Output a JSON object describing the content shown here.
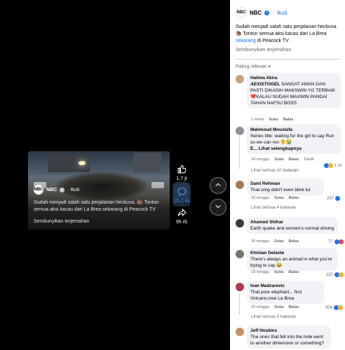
{
  "post": {
    "page_name": "NBC",
    "follow_label": "Ikuti",
    "follow_separator": "·",
    "caption": "Sudah menjadi salah satu perjalanan heckuva. 🦣 Tonton semua aksi kacau dari La Brea",
    "caption_link": "sekarang",
    "caption_tail": "di Peacock TV",
    "hide_translation": "Sembunyikan terjemahan",
    "sort_label": "Paling relevan ▾",
    "logo_text": "NBC"
  },
  "video": {
    "page_name": "NBC",
    "follow_label": "· Ikuti",
    "caption": "Sudah menjadi salah satu perjalanan heckuva. 🦣 Tonton semua aksi kacau dari La Brea sekarang di Peacock TV",
    "hide_translation": "Sembunyikan terjemahan"
  },
  "rail": {
    "likes_count": "1,7 jt",
    "comments_count": "20,2 rb",
    "shares_count": "95 rb"
  },
  "comments": [
    {
      "author": "Halima Akira",
      "text_bold": "AEXISTOGEL",
      "text": " SANGAT AMAN DAN PASTI DIKASIH MAKSWIN YG TERBAIK❤️KALAU SUDAH MAXWIN PANDAI TAHAN NAFSU BOSS",
      "time": "1 menit",
      "like": "Suka",
      "reply": "Balas"
    },
    {
      "author": "Mahmoud Moustafa",
      "text": "Series title: waiting for the girl to say Run so we can run 🫠😭",
      "see_more": "E... Lihat selengkapnya",
      "time": "34 minggu",
      "like": "Suka",
      "reply": "Balas",
      "edited": "Diedit",
      "reactions": "1 rb",
      "view_replies": "Lihat semua 10 balasan"
    },
    {
      "author": "Sami Rehman",
      "text": "That omg didn't even blink lul",
      "time": "29 minggu",
      "like": "Suka",
      "reply": "Balas",
      "reactions": "257",
      "view_replies": "Lihat semua 4 balasan"
    },
    {
      "author": "Ahamed Shihar",
      "text": "Earth quake and women's normal driving",
      "time": "26 minggu",
      "like": "Suka",
      "reply": "Balas",
      "reactions": "77"
    },
    {
      "author": "Khinlan Delante",
      "text": "There's always an animal in what you're trying to say 😂",
      "time": "18 minggu",
      "like": "Suka",
      "reply": "Balas",
      "reactions": "110"
    },
    {
      "author": "Ivan Madzarevic",
      "text": "That poor elephant... first Volcano,now La Brea",
      "time": "33 minggu",
      "like": "Suka",
      "reply": "Balas",
      "reactions": "304",
      "view_replies": "Lihat semua 5 balasan"
    },
    {
      "author": "Jeff Hoskins",
      "text": "The ones that fell into the hole went to another dimension or something?"
    }
  ],
  "colors": {
    "accent": "#1877f2",
    "like_blue": "#1877f2",
    "love_red": "#f33e58",
    "haha_yellow": "#f7b125"
  },
  "icons": {
    "like": "thumbs-up-icon",
    "comment": "comment-icon",
    "share": "share-icon",
    "prev": "chevron-up-icon",
    "next": "chevron-down-icon"
  }
}
